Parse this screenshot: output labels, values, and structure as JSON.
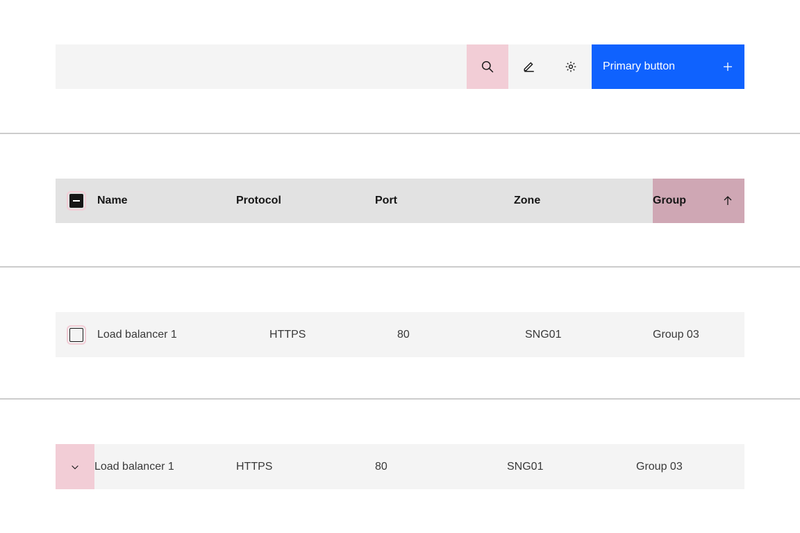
{
  "toolbar": {
    "primary_label": "Primary button"
  },
  "columns": {
    "name": "Name",
    "protocol": "Protocol",
    "port": "Port",
    "zone": "Zone",
    "group": "Group"
  },
  "rows": [
    {
      "name": "Load balancer 1",
      "protocol": "HTTPS",
      "port": "80",
      "zone": "SNG01",
      "group": "Group 03"
    },
    {
      "name": "Load balancer 1",
      "protocol": "HTTPS",
      "port": "80",
      "zone": "SNG01",
      "group": "Group 03"
    }
  ]
}
